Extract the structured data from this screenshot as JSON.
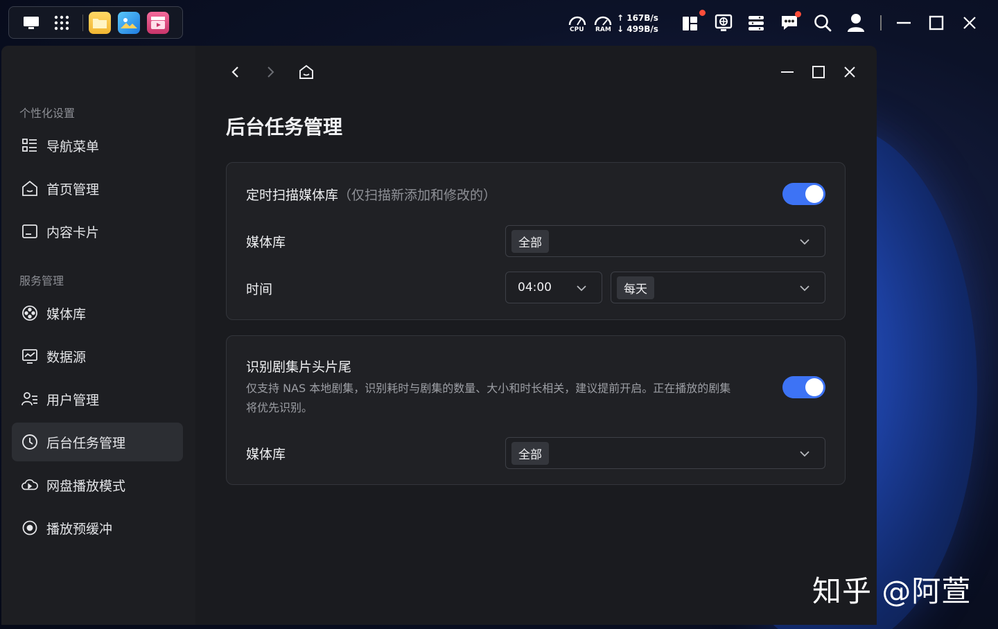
{
  "taskbar": {
    "net_up": "↑ 167B/s",
    "net_down": "↓ 499B/s",
    "cpu_label": "CPU",
    "ram_label": "RAM"
  },
  "sidebar": {
    "section1": "个性化设置",
    "section2": "服务管理",
    "items": [
      {
        "label": "导航菜单",
        "icon": "nav-menu-icon"
      },
      {
        "label": "首页管理",
        "icon": "home-icon"
      },
      {
        "label": "内容卡片",
        "icon": "card-icon"
      },
      {
        "label": "媒体库",
        "icon": "media-library-icon"
      },
      {
        "label": "数据源",
        "icon": "data-source-icon"
      },
      {
        "label": "用户管理",
        "icon": "users-icon"
      },
      {
        "label": "后台任务管理",
        "icon": "clock-icon",
        "active": true
      },
      {
        "label": "网盘播放模式",
        "icon": "cloud-icon"
      },
      {
        "label": "播放预缓冲",
        "icon": "record-icon"
      }
    ]
  },
  "page": {
    "title": "后台任务管理"
  },
  "scan_card": {
    "title": "定时扫描媒体库",
    "note": "（仅扫描新添加和修改的）",
    "enabled": true,
    "library_label": "媒体库",
    "library_value": "全部",
    "time_label": "时间",
    "time_value": "04:00",
    "frequency_value": "每天"
  },
  "intro_card": {
    "title": "识别剧集片头片尾",
    "desc_line1": "仅支持 NAS 本地剧集，识别耗时与剧集的数量、大小和时长相关，建议提前开启。正在播放的剧集",
    "desc_line2": "将优先识别。",
    "enabled": true,
    "library_label": "媒体库",
    "library_value": "全部"
  },
  "watermark": "知乎 @阿萱",
  "colors": {
    "accent": "#3d73f5",
    "background": "#1a1b1f",
    "card": "#202125"
  }
}
